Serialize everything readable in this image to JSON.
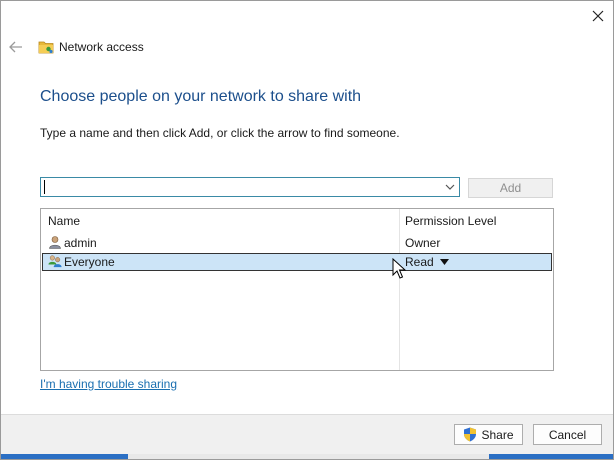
{
  "window": {
    "title": "Network access",
    "close_icon": "close-icon",
    "back_icon": "back-arrow-icon",
    "title_icon": "shared-folder-icon"
  },
  "main": {
    "heading": "Choose people on your network to share with",
    "instructions": "Type a name and then click Add, or click the arrow to find someone.",
    "name_input": {
      "value": "",
      "placeholder": ""
    },
    "add_label": "Add"
  },
  "list": {
    "columns": {
      "name": "Name",
      "permission": "Permission Level"
    },
    "rows": [
      {
        "name": "admin",
        "permission": "Owner",
        "icon": "user-icon",
        "selected": false
      },
      {
        "name": "Everyone",
        "permission": "Read",
        "icon": "group-icon",
        "selected": true
      }
    ]
  },
  "links": {
    "trouble": "I'm having trouble sharing"
  },
  "footer": {
    "share_label": "Share",
    "cancel_label": "Cancel",
    "share_icon": "uac-shield-icon"
  },
  "colors": {
    "heading": "#1c4f8c",
    "link": "#1a6fb0",
    "selection": "#cce4f7",
    "input_border": "#3a8aa6"
  }
}
